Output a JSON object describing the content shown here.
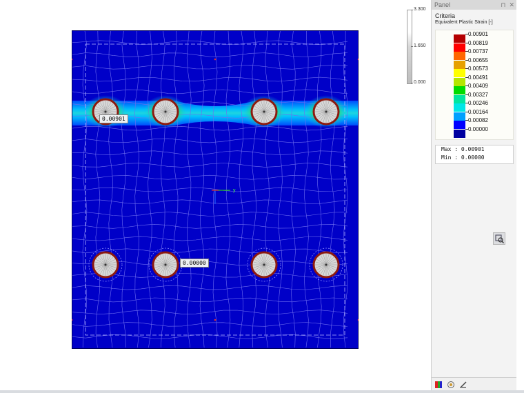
{
  "scale": {
    "max_label": "3.300",
    "mid_label": "1.650",
    "min_label": "0.000"
  },
  "model": {
    "bolt_labels": [
      "0.00901",
      "0.00000"
    ],
    "axis_label": "y",
    "colors": {
      "plate": "#0000c8",
      "mesh": "#6e6ef0",
      "bolt_fill": "#d8d8d8",
      "bolt_ring": "#8c1a10"
    }
  },
  "panel": {
    "title": "Panel",
    "pin_icon": "pin-icon",
    "close_icon": "close-icon",
    "criteria_title": "Criteria",
    "criteria_sub": "Equivalent Plastic Strain [-]",
    "legend": [
      {
        "value": "0.00901",
        "color": "#b40000"
      },
      {
        "value": "0.00819",
        "color": "#ff0000"
      },
      {
        "value": "0.00737",
        "color": "#ff6600"
      },
      {
        "value": "0.00655",
        "color": "#e6a000"
      },
      {
        "value": "0.00573",
        "color": "#ffff00"
      },
      {
        "value": "0.00491",
        "color": "#b4e600"
      },
      {
        "value": "0.00409",
        "color": "#00dc00"
      },
      {
        "value": "0.00327",
        "color": "#00e6a0"
      },
      {
        "value": "0.00246",
        "color": "#00e6e6"
      },
      {
        "value": "0.00164",
        "color": "#00a0ff"
      },
      {
        "value": "0.00082",
        "color": "#0000ff"
      },
      {
        "value": "0.00000",
        "color": "#0000a0"
      }
    ],
    "max_row": "Max  :  0.00901",
    "min_row": "Min  :  0.00000",
    "tool_icon": "zoom-settings-icon",
    "bottom_icons": [
      "color-scale-icon",
      "visibility-icon",
      "display-settings-icon"
    ]
  }
}
